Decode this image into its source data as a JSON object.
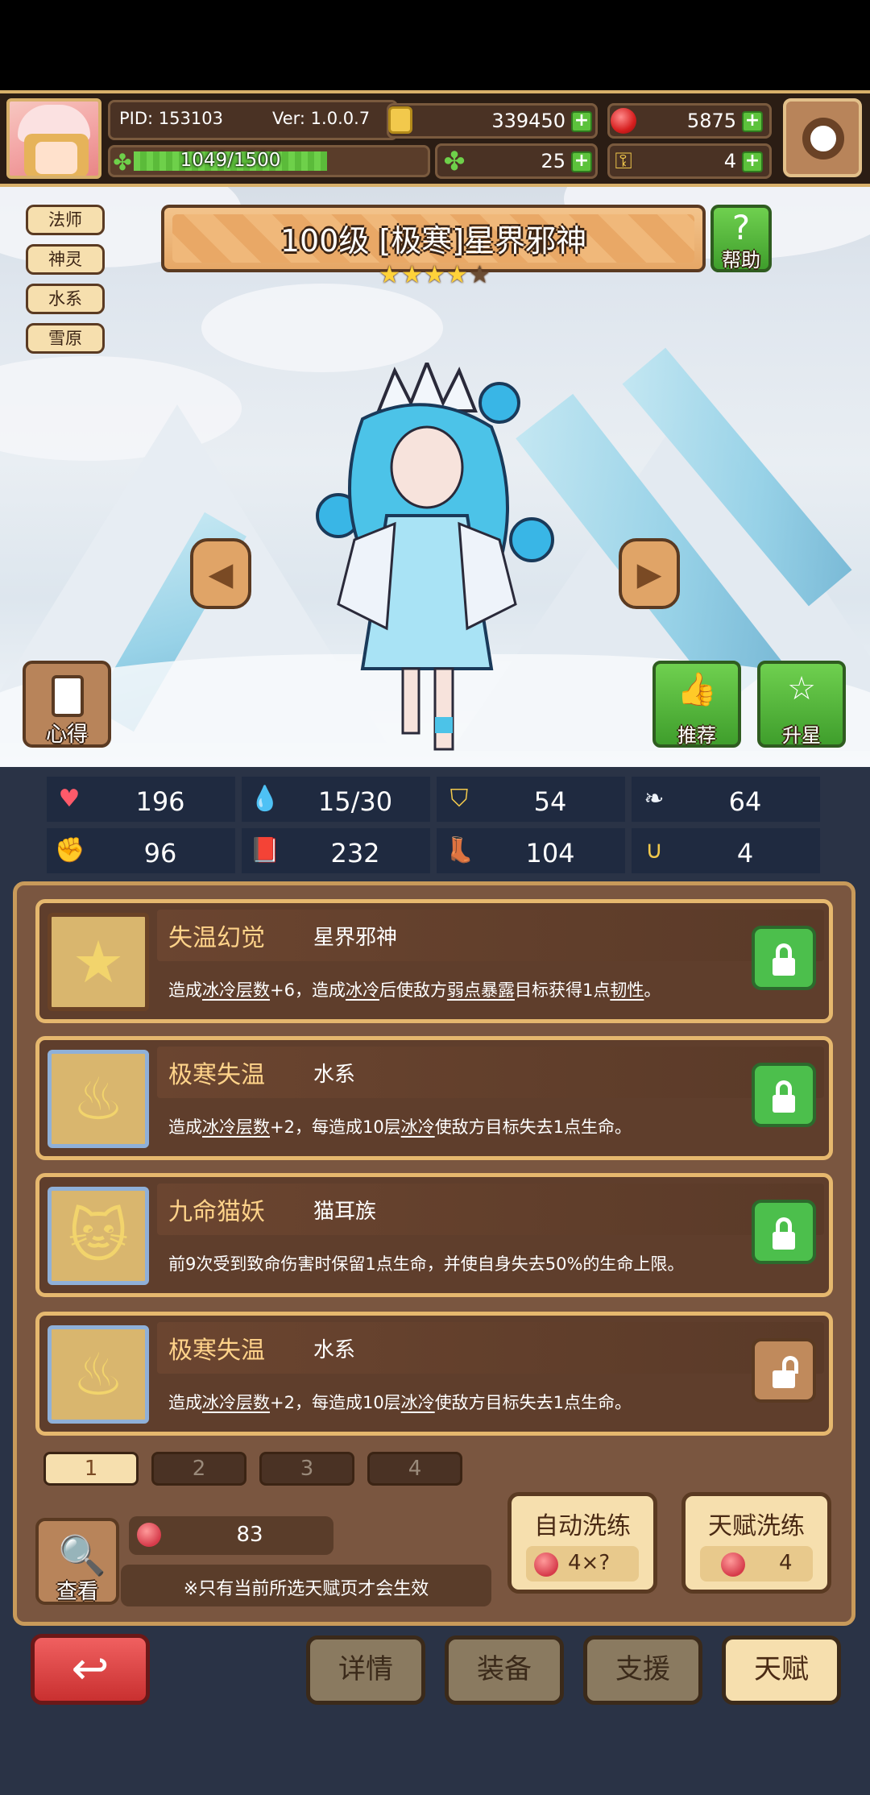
{
  "header": {
    "pid": "PID: 153103",
    "version": "Ver: 1.0.0.7",
    "exp": "1049/1500",
    "exp_fraction": 0.7,
    "gold": "339450",
    "rubies": "5875",
    "clover": "25",
    "keys": "4"
  },
  "tags": [
    "法师",
    "神灵",
    "水系",
    "雪原"
  ],
  "title": "100级 [极寒]星界邪神",
  "stars": {
    "filled": 4,
    "total": 5
  },
  "buttons": {
    "help": "帮助",
    "insight": "心得",
    "recommend": "推荐",
    "upgrade_star": "升星"
  },
  "stats": [
    {
      "icon": "heart-icon",
      "value": "196"
    },
    {
      "icon": "mana-drop-icon",
      "value": "15/30"
    },
    {
      "icon": "shield-icon",
      "value": "54"
    },
    {
      "icon": "wing-icon",
      "value": "64"
    },
    {
      "icon": "fist-icon",
      "value": "96"
    },
    {
      "icon": "book-icon",
      "value": "232"
    },
    {
      "icon": "boot-icon",
      "value": "104"
    },
    {
      "icon": "horseshoe-icon",
      "value": "4"
    }
  ],
  "talents": [
    {
      "name": "失温幻觉",
      "sub": "星界邪神",
      "desc_parts": [
        "造成",
        "冰冷层数",
        "+6，造成",
        "冰冷",
        "后使敌方",
        "弱点暴露",
        "目标获得1点",
        "韧性",
        "。"
      ],
      "locked": true
    },
    {
      "name": "极寒失温",
      "sub": "水系",
      "desc_parts": [
        "造成",
        "冰冷层数",
        "+2，每造成10层",
        "冰冷",
        "使敌方目标失去1点生命。"
      ],
      "locked": true
    },
    {
      "name": "九命猫妖",
      "sub": "猫耳族",
      "desc_parts": [
        "前9次受到致命伤害时保留1点生命，并使自身失去50%的生命上限。"
      ],
      "locked": true
    },
    {
      "name": "极寒失温",
      "sub": "水系",
      "desc_parts": [
        "造成",
        "冰冷层数",
        "+2，每造成10层",
        "冰冷",
        "使敌方目标失去1点生命。"
      ],
      "locked": false
    }
  ],
  "pages": [
    "1",
    "2",
    "3",
    "4"
  ],
  "active_page": "1",
  "view_label": "查看",
  "fruit_count": "83",
  "note": "※只有当前所选天赋页才会生效",
  "auto_wash": {
    "label": "自动洗练",
    "cost": "4×?"
  },
  "talent_wash": {
    "label": "天赋洗练",
    "cost": "4"
  },
  "nav": [
    "详情",
    "装备",
    "支援",
    "天赋"
  ],
  "active_nav": "天赋",
  "colors": {
    "accent": "#e6b86e",
    "panel": "#5f3e2c",
    "green": "#4cbf4c",
    "back": "#d94040"
  }
}
